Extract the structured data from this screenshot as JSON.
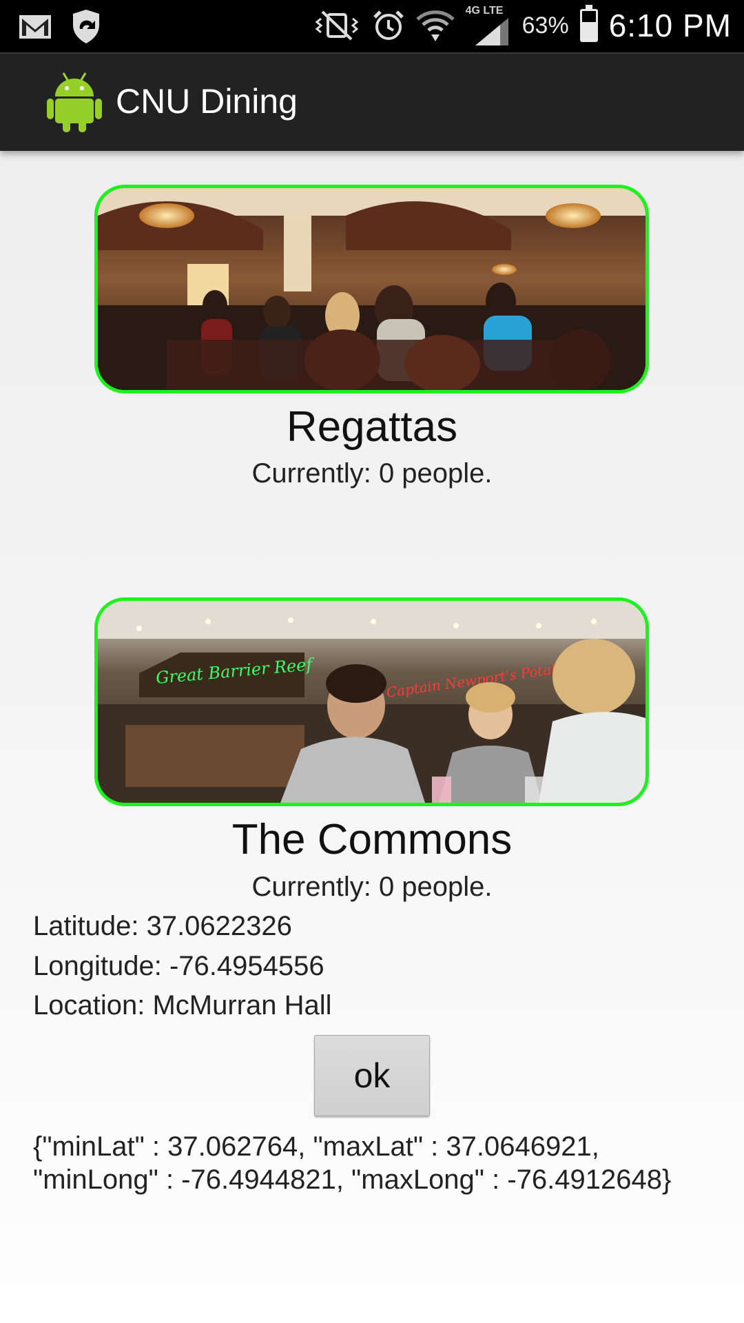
{
  "status_bar": {
    "icons": [
      "gmail-icon",
      "shield-sync-icon",
      "vibrate-mute-icon",
      "alarm-icon",
      "wifi-icon",
      "lte-signal-icon",
      "battery-icon"
    ],
    "network_type": "4G LTE",
    "battery_percent": "63%",
    "battery_level": 0.63,
    "time": "6:10 PM"
  },
  "action_bar": {
    "app_icon": "android-icon",
    "title": "CNU Dining"
  },
  "venues": [
    {
      "name": "Regattas",
      "count_text": "Currently: 0 people."
    },
    {
      "name": "The Commons",
      "count_text": "Currently: 0 people."
    }
  ],
  "location": {
    "latitude_text": "Latitude: 37.0622326",
    "longitude_text": "Longitude: -76.4954556",
    "location_text": "Location: McMurran Hall"
  },
  "ok_button": {
    "label": "ok"
  },
  "bounds_text": "{\"minLat\" : 37.062764, \"maxLat\" : 37.0646921, \"minLong\" : -76.4944821, \"maxLong\" : -76.4912648}",
  "colors": {
    "card_border": "#1cf21c",
    "action_bar": "#222222",
    "status_bar": "#000000"
  }
}
